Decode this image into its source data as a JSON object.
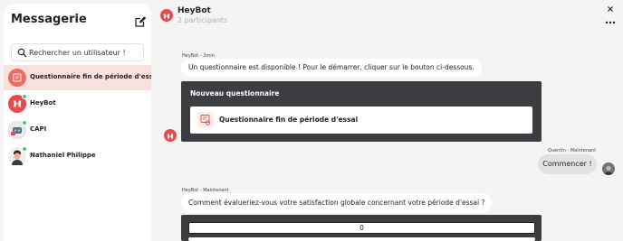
{
  "sidebar": {
    "title": "Messagerie",
    "search_placeholder": "Rechercher un utilisateur !",
    "conversations": [
      {
        "name": "Questionnaire fin de période d'essai",
        "active": true
      },
      {
        "name": "HeyBot",
        "active": false
      },
      {
        "name": "CAPI",
        "active": false
      },
      {
        "name": "Nathaniel Philippe",
        "active": false
      }
    ]
  },
  "header": {
    "name": "HeyBot",
    "participants": "2 participants"
  },
  "messages": [
    {
      "meta": "HeyBot - 2min",
      "text": "Un questionnaire est disponible ! Pour le démarrer, cliquer sur le bouton ci-dessous."
    },
    {
      "card_title": "Nouveau questionnaire",
      "survey_label": "Questionnaire fin de période d'essai"
    },
    {
      "meta": "Quentin - Maintenant",
      "text": "Commencer !"
    },
    {
      "meta": "HeyBot - Maintenant",
      "text": "Comment évalueriez-vous votre satisfaction globale concernant votre période d'essai ?"
    },
    {
      "rating_value": "0"
    }
  ],
  "colors": {
    "accent": "#e84b4b",
    "active_row": "#fbe1dd",
    "card_bg": "#3b3d40",
    "online": "#3ecf6e"
  }
}
